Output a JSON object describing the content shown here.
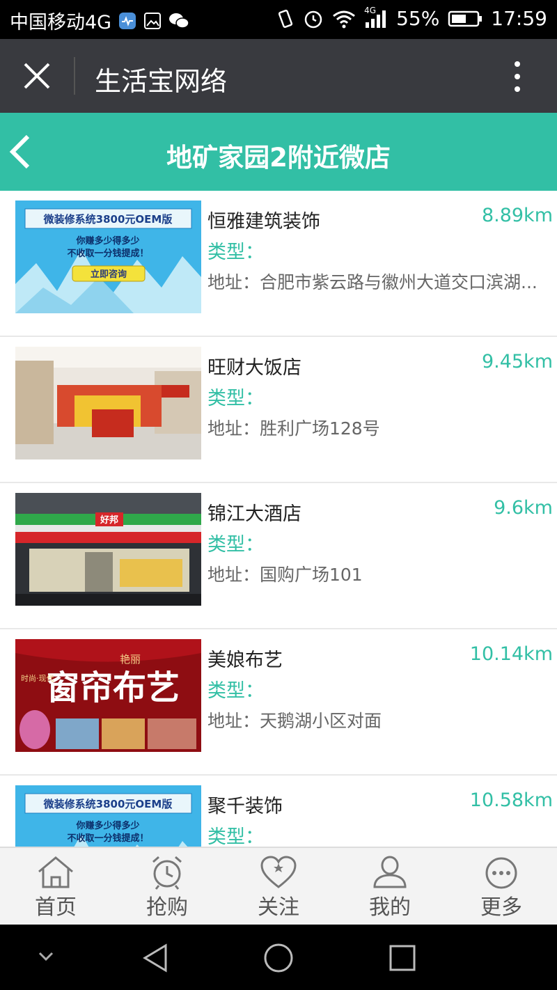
{
  "status_bar": {
    "carrier": "中国移动4G",
    "network_tag": "4G",
    "battery": "55%",
    "time": "17:59"
  },
  "app_bar": {
    "title": "生活宝网络",
    "close_icon": "close-icon",
    "menu_icon": "more-vertical-icon"
  },
  "header": {
    "title": "地矿家园2附近微店",
    "back_icon": "chevron-left-icon"
  },
  "ad_banner": {
    "headline": "微装修系统3800元OEM版",
    "line1": "你赚多少得多少",
    "line2": "不收取一分钱提成！",
    "button": "立即咨询"
  },
  "curtain_banner": {
    "brand": "艳丽",
    "headline": "窗帘布艺",
    "side": "时尚·现代"
  },
  "store_sign": "好邦",
  "labels": {
    "type": "类型："
  },
  "shops": [
    {
      "name": "恒雅建筑装饰",
      "distance": "8.89km",
      "address": "地址：合肥市紫云路与徽州大道交口滨湖..."
    },
    {
      "name": "旺财大饭店",
      "distance": "9.45km",
      "address": "地址：胜利广场128号"
    },
    {
      "name": "锦江大酒店",
      "distance": "9.6km",
      "address": "地址：国购广场101"
    },
    {
      "name": "美娘布艺",
      "distance": "10.14km",
      "address": "地址：天鹅湖小区对面"
    },
    {
      "name": "聚千装饰",
      "distance": "10.58km",
      "address": ""
    }
  ],
  "tabs": [
    {
      "label": "首页",
      "icon": "home-icon"
    },
    {
      "label": "抢购",
      "icon": "alarm-clock-icon"
    },
    {
      "label": "关注",
      "icon": "heart-icon"
    },
    {
      "label": "我的",
      "icon": "user-icon"
    },
    {
      "label": "更多",
      "icon": "more-horizontal-icon"
    }
  ],
  "colors": {
    "accent": "#32bfa5",
    "app_bar": "#393a3f"
  }
}
